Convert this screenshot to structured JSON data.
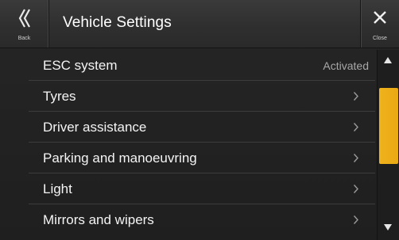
{
  "header": {
    "title": "Vehicle Settings",
    "back_label": "Back",
    "close_label": "Close"
  },
  "icons": {
    "back": "double-chevron-left-icon",
    "close": "close-x-icon",
    "row_arrow": "chevron-right-icon",
    "scroll_up": "triangle-up-icon",
    "scroll_down": "triangle-down-icon"
  },
  "list": {
    "items": [
      {
        "label": "ESC system",
        "value": "Activated"
      },
      {
        "label": "Tyres"
      },
      {
        "label": "Driver assistance"
      },
      {
        "label": "Parking and manoeuvring"
      },
      {
        "label": "Light"
      },
      {
        "label": "Mirrors and wipers"
      }
    ]
  },
  "scrollbar": {
    "position": 0.2,
    "visible_fraction": 0.5
  },
  "colors": {
    "accent": "#f0b21c",
    "text": "#f4f4f4",
    "secondary_text": "#a8a8a8",
    "background": "#232323"
  }
}
